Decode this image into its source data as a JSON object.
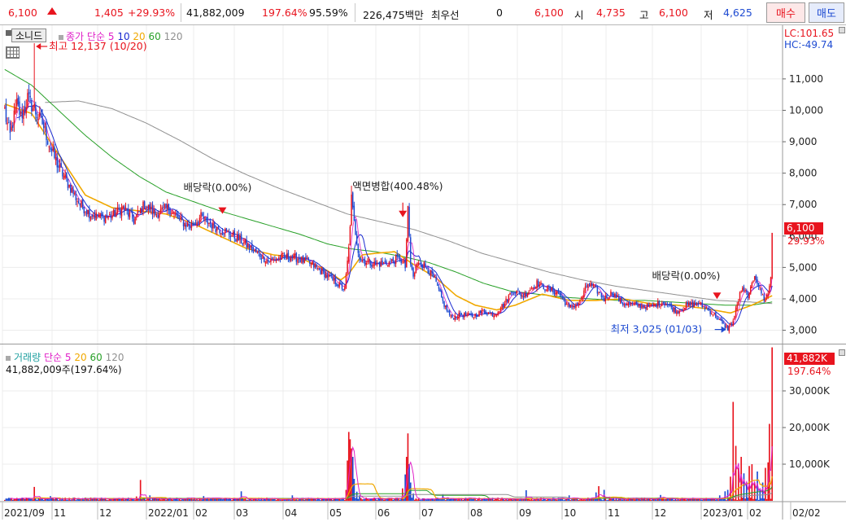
{
  "topbar": {
    "price": "6,100",
    "change": "1,405",
    "change_pct": "+29.93%",
    "volume": "41,882,009",
    "volume_ratio": "197.64%",
    "turnover_ratio": "95.59%",
    "amount": "226,475백만",
    "priority_label": "최우선",
    "priority_value": "0",
    "current_price": "6,100",
    "open_label": "시",
    "open_value": "4,735",
    "high_label": "고",
    "high_value": "6,100",
    "low_label": "저",
    "low_value": "4,625",
    "buy_label": "매수",
    "sell_label": "매도"
  },
  "legend": {
    "stock_name": "소니드",
    "price_label": "종가",
    "ma_type": "단순",
    "ma5": "5",
    "ma10": "10",
    "ma20": "20",
    "ma60": "60",
    "ma120": "120",
    "volume_label": "거래량",
    "volume_info": "41,882,009주(197.64%)"
  },
  "right_labels": {
    "lc": "LC:101.65",
    "hc": "HC:-49.74",
    "last_price": "6,100",
    "last_pct": "29.93%",
    "last_volume": "41,882K",
    "last_volume_pct": "197.64%"
  },
  "annotations": {
    "high": "최고 12,137 (10/20)",
    "low": "최저 3,025 (01/03)",
    "dividend1": "배당락(0.00%)",
    "merger": "액면병합(400.48%)",
    "dividend2": "배당락(0.00%)"
  },
  "colors": {
    "up": "#e8141e",
    "down": "#1e4bd2",
    "ma5": "#e020c8",
    "ma10": "#1a2ad0",
    "ma20": "#f0a800",
    "ma60": "#28a028",
    "ma120": "#909090",
    "volume_label": "#20a0a0",
    "grid": "#e2e2e2"
  },
  "chart_data": [
    {
      "type": "candlestick",
      "title": "소니드",
      "ylim": [
        2600,
        12500
      ],
      "yticks": [
        "3,000",
        "4,000",
        "5,000",
        "6,000",
        "7,000",
        "8,000",
        "9,000",
        "10,000",
        "11,000"
      ],
      "x_labels": [
        "2021/09",
        "11",
        "12",
        "2022/01",
        "02",
        "03",
        "04",
        "05",
        "06",
        "07",
        "08",
        "09",
        "10",
        "11",
        "12",
        "2023/01",
        "02",
        "02/02"
      ],
      "anchors": [
        [
          0,
          9900
        ],
        [
          4,
          9200
        ],
        [
          9,
          10200
        ],
        [
          12,
          9800
        ],
        [
          15,
          10100
        ],
        [
          17,
          10400
        ],
        [
          22,
          10000
        ],
        [
          28,
          9600
        ],
        [
          34,
          8800
        ],
        [
          40,
          8200
        ],
        [
          48,
          7600
        ],
        [
          56,
          7000
        ],
        [
          64,
          6700
        ],
        [
          72,
          6600
        ],
        [
          80,
          6650
        ],
        [
          88,
          6900
        ],
        [
          96,
          6500
        ],
        [
          104,
          7000
        ],
        [
          112,
          6700
        ],
        [
          122,
          6900
        ],
        [
          130,
          6500
        ],
        [
          138,
          6300
        ],
        [
          146,
          6600
        ],
        [
          156,
          6300
        ],
        [
          166,
          6100
        ],
        [
          176,
          5850
        ],
        [
          186,
          5500
        ],
        [
          196,
          5200
        ],
        [
          208,
          5350
        ],
        [
          218,
          5300
        ],
        [
          228,
          5100
        ],
        [
          238,
          4800
        ],
        [
          244,
          4600
        ],
        [
          250,
          4400
        ],
        [
          253,
          4300
        ],
        [
          256,
          5600
        ],
        [
          258,
          7200
        ],
        [
          260,
          6400
        ],
        [
          264,
          5300
        ],
        [
          268,
          5200
        ],
        [
          276,
          5100
        ],
        [
          286,
          5150
        ],
        [
          294,
          5300
        ],
        [
          298,
          5000
        ],
        [
          300,
          6800
        ],
        [
          302,
          5100
        ],
        [
          304,
          4700
        ],
        [
          308,
          5200
        ],
        [
          314,
          5000
        ],
        [
          320,
          4600
        ],
        [
          326,
          3900
        ],
        [
          332,
          3400
        ],
        [
          340,
          3500
        ],
        [
          348,
          3450
        ],
        [
          356,
          3600
        ],
        [
          364,
          3500
        ],
        [
          372,
          3850
        ],
        [
          378,
          4300
        ],
        [
          386,
          4100
        ],
        [
          396,
          4500
        ],
        [
          404,
          4300
        ],
        [
          412,
          4200
        ],
        [
          420,
          3700
        ],
        [
          428,
          3900
        ],
        [
          434,
          4500
        ],
        [
          440,
          4300
        ],
        [
          446,
          4000
        ],
        [
          452,
          4200
        ],
        [
          460,
          3850
        ],
        [
          470,
          3800
        ],
        [
          480,
          3750
        ],
        [
          490,
          3900
        ],
        [
          500,
          3600
        ],
        [
          508,
          3800
        ],
        [
          516,
          3850
        ],
        [
          522,
          3700
        ],
        [
          528,
          3500
        ],
        [
          534,
          3200
        ],
        [
          538,
          3050
        ],
        [
          542,
          3300
        ],
        [
          548,
          4300
        ],
        [
          554,
          4100
        ],
        [
          558,
          4800
        ],
        [
          562,
          4300
        ],
        [
          565,
          4000
        ],
        [
          568,
          4150
        ],
        [
          570,
          4700
        ],
        [
          571,
          6100
        ]
      ],
      "ma20_anchors": [
        [
          0,
          10200
        ],
        [
          20,
          9900
        ],
        [
          40,
          8600
        ],
        [
          60,
          7300
        ],
        [
          80,
          6900
        ],
        [
          100,
          6800
        ],
        [
          120,
          6700
        ],
        [
          140,
          6400
        ],
        [
          160,
          6000
        ],
        [
          180,
          5600
        ],
        [
          200,
          5400
        ],
        [
          220,
          5300
        ],
        [
          240,
          4900
        ],
        [
          250,
          4600
        ],
        [
          256,
          4800
        ],
        [
          266,
          5400
        ],
        [
          276,
          5450
        ],
        [
          290,
          5500
        ],
        [
          304,
          5100
        ],
        [
          320,
          4700
        ],
        [
          336,
          4100
        ],
        [
          350,
          3800
        ],
        [
          366,
          3650
        ],
        [
          380,
          3800
        ],
        [
          400,
          4150
        ],
        [
          420,
          3950
        ],
        [
          440,
          3950
        ],
        [
          460,
          4000
        ],
        [
          480,
          3850
        ],
        [
          500,
          3800
        ],
        [
          520,
          3700
        ],
        [
          540,
          3550
        ],
        [
          556,
          3800
        ],
        [
          571,
          4100
        ]
      ],
      "ma60_anchors": [
        [
          0,
          11300
        ],
        [
          20,
          10800
        ],
        [
          40,
          10000
        ],
        [
          60,
          9200
        ],
        [
          80,
          8500
        ],
        [
          100,
          7900
        ],
        [
          120,
          7400
        ],
        [
          140,
          7100
        ],
        [
          160,
          6800
        ],
        [
          180,
          6550
        ],
        [
          200,
          6300
        ],
        [
          220,
          6050
        ],
        [
          240,
          5750
        ],
        [
          256,
          5600
        ],
        [
          276,
          5500
        ],
        [
          296,
          5350
        ],
        [
          316,
          5150
        ],
        [
          336,
          4850
        ],
        [
          356,
          4500
        ],
        [
          376,
          4250
        ],
        [
          396,
          4150
        ],
        [
          416,
          4050
        ],
        [
          436,
          4000
        ],
        [
          456,
          3950
        ],
        [
          476,
          3950
        ],
        [
          496,
          3900
        ],
        [
          516,
          3850
        ],
        [
          536,
          3800
        ],
        [
          556,
          3800
        ],
        [
          571,
          3900
        ]
      ],
      "ma120_anchors": [
        [
          30,
          10250
        ],
        [
          55,
          10300
        ],
        [
          80,
          10050
        ],
        [
          105,
          9600
        ],
        [
          130,
          9050
        ],
        [
          155,
          8450
        ],
        [
          180,
          7950
        ],
        [
          205,
          7500
        ],
        [
          230,
          7100
        ],
        [
          255,
          6700
        ],
        [
          280,
          6450
        ],
        [
          305,
          6200
        ],
        [
          330,
          5850
        ],
        [
          355,
          5450
        ],
        [
          380,
          5150
        ],
        [
          405,
          4850
        ],
        [
          430,
          4600
        ],
        [
          455,
          4400
        ],
        [
          480,
          4250
        ],
        [
          505,
          4100
        ],
        [
          530,
          3950
        ],
        [
          555,
          3900
        ],
        [
          571,
          3850
        ]
      ]
    },
    {
      "type": "bar",
      "title": "거래량",
      "ylim": [
        0,
        42000
      ],
      "yticks": [
        "10,000K",
        "20,000K",
        "30,000K"
      ],
      "unit": "K",
      "spikes": [
        [
          2,
          600
        ],
        [
          9,
          800
        ],
        [
          22,
          3800
        ],
        [
          34,
          1300
        ],
        [
          64,
          900
        ],
        [
          98,
          1200
        ],
        [
          101,
          5700
        ],
        [
          108,
          1500
        ],
        [
          148,
          1300
        ],
        [
          176,
          2600
        ],
        [
          199,
          800
        ],
        [
          214,
          1500
        ],
        [
          245,
          700
        ],
        [
          254,
          3000
        ],
        [
          255,
          11000
        ],
        [
          256,
          18800
        ],
        [
          257,
          16800
        ],
        [
          258,
          14300
        ],
        [
          259,
          12000
        ],
        [
          260,
          6000
        ],
        [
          262,
          2500
        ],
        [
          264,
          1500
        ],
        [
          296,
          3400
        ],
        [
          298,
          7200
        ],
        [
          299,
          12000
        ],
        [
          300,
          18400
        ],
        [
          301,
          10000
        ],
        [
          302,
          5000
        ],
        [
          304,
          2000
        ],
        [
          326,
          1800
        ],
        [
          346,
          900
        ],
        [
          388,
          2900
        ],
        [
          420,
          1500
        ],
        [
          440,
          2300
        ],
        [
          442,
          4000
        ],
        [
          446,
          3000
        ],
        [
          488,
          1600
        ],
        [
          532,
          1500
        ],
        [
          536,
          2600
        ],
        [
          538,
          3000
        ],
        [
          540,
          6600
        ],
        [
          542,
          27000
        ],
        [
          544,
          15000
        ],
        [
          546,
          9000
        ],
        [
          548,
          12000
        ],
        [
          550,
          7500
        ],
        [
          552,
          5000
        ],
        [
          554,
          9500
        ],
        [
          556,
          10000
        ],
        [
          558,
          5000
        ],
        [
          560,
          8000
        ],
        [
          562,
          3000
        ],
        [
          564,
          5000
        ],
        [
          566,
          9000
        ],
        [
          568,
          10500
        ],
        [
          569,
          21000
        ],
        [
          571,
          41882
        ]
      ]
    }
  ]
}
